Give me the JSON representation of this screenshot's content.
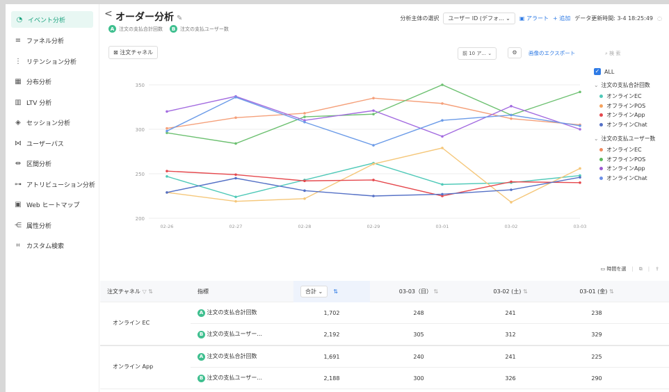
{
  "sidebar": {
    "items": [
      {
        "label": "イベント分析",
        "icon": "event-icon"
      },
      {
        "label": "ファネル分析",
        "icon": "funnel-icon"
      },
      {
        "label": "リテンション分析",
        "icon": "retention-icon"
      },
      {
        "label": "分布分析",
        "icon": "distribution-icon"
      },
      {
        "label": "LTV 分析",
        "icon": "ltv-icon"
      },
      {
        "label": "セッション分析",
        "icon": "session-icon"
      },
      {
        "label": "ユーザーパス",
        "icon": "path-icon"
      },
      {
        "label": "区間分析",
        "icon": "interval-icon"
      },
      {
        "label": "アトリビューション分析",
        "icon": "attribution-icon"
      },
      {
        "label": "Web ヒートマップ",
        "icon": "heatmap-icon"
      },
      {
        "label": "属性分析",
        "icon": "attribute-icon"
      },
      {
        "label": "カスタム検索",
        "icon": "custom-search-icon"
      }
    ]
  },
  "header": {
    "back": "<",
    "title": "オーダー分析",
    "metric_a": "注文の支払合計回数",
    "metric_b": "注文の支払ユーザー数",
    "subject_label": "分析主体の選択",
    "subject_value": "ユーザー ID (デフォ...",
    "alert": "アラート",
    "add": "+ 追加",
    "updated": "データ更新時間: 3-4 18:25:49"
  },
  "controls": {
    "channel": "注文チャネル",
    "prev": "前 10 ア...",
    "export": "画像のエクスポート",
    "search_placeholder": "検 索",
    "time_select": "時間を選"
  },
  "legend": {
    "all": "ALL",
    "groups": [
      {
        "name": "注文の支払合計回数",
        "items": [
          {
            "name": "オンラインEC",
            "color": "#4fc9b8"
          },
          {
            "name": "オフラインPOS",
            "color": "#f5a25d"
          },
          {
            "name": "オンラインApp",
            "color": "#e5484d"
          },
          {
            "name": "オンラインChat",
            "color": "#5470c6"
          }
        ]
      },
      {
        "name": "注文の支払ユーザー数",
        "items": [
          {
            "name": "オンラインEC",
            "color": "#f08a5d"
          },
          {
            "name": "オフラインPOS",
            "color": "#5cb85c"
          },
          {
            "name": "オンラインApp",
            "color": "#9b59d0"
          },
          {
            "name": "オンラインChat",
            "color": "#6b8fe8"
          }
        ]
      }
    ]
  },
  "chart_data": {
    "type": "line",
    "x": [
      "02-26",
      "02-27",
      "02-28",
      "02-29",
      "03-01",
      "03-02",
      "03-03"
    ],
    "ylim": [
      200,
      350
    ],
    "yticks": [
      200,
      250,
      300,
      350
    ],
    "series": [
      {
        "name": "注文の支払合計回数 - オンラインEC",
        "color": "#4fc9b8",
        "values": [
          247,
          224,
          243,
          262,
          238,
          240,
          248
        ]
      },
      {
        "name": "注文の支払合計回数 - オフラインPOS",
        "color": "#f5c77a",
        "values": [
          229,
          219,
          222,
          261,
          279,
          218,
          256
        ]
      },
      {
        "name": "注文の支払合計回数 - オンラインApp",
        "color": "#e5484d",
        "values": [
          253,
          249,
          242,
          243,
          225,
          241,
          240
        ]
      },
      {
        "name": "注文の支払合計回数 - オンラインChat",
        "color": "#5470c6",
        "values": [
          229,
          245,
          231,
          225,
          227,
          232,
          246
        ]
      },
      {
        "name": "注文の支払ユーザー数 - オンラインEC",
        "color": "#f5a07a",
        "values": [
          301,
          313,
          318,
          335,
          329,
          312,
          305
        ]
      },
      {
        "name": "注文の支払ユーザー数 - オフラインPOS",
        "color": "#6cc070",
        "values": [
          296,
          284,
          314,
          317,
          350,
          316,
          342
        ]
      },
      {
        "name": "注文の支払ユーザー数 - オンラインApp",
        "color": "#a36ce0",
        "values": [
          320,
          337,
          310,
          321,
          292,
          326,
          300
        ]
      },
      {
        "name": "注文の支払ユーザー数 - オンラインChat",
        "color": "#6b9be8",
        "values": [
          298,
          336,
          308,
          282,
          310,
          316,
          304
        ]
      }
    ]
  },
  "table": {
    "headers": [
      "注文チャネル",
      "指標",
      "合計",
      "03-03（日）",
      "03-02 (土)",
      "03-01 (金)"
    ],
    "sum_label": "合計",
    "groups": [
      {
        "channel": "オンライン EC",
        "rows": [
          {
            "badge": "A",
            "metric": "注文の支払合計回数",
            "total": "1,702",
            "d1": "248",
            "d2": "241",
            "d3": "238"
          },
          {
            "badge": "B",
            "metric": "注文の支払ユーザー...",
            "total": "2,192",
            "d1": "305",
            "d2": "312",
            "d3": "329"
          }
        ]
      },
      {
        "channel": "オンライン App",
        "rows": [
          {
            "badge": "A",
            "metric": "注文の支払合計回数",
            "total": "1,691",
            "d1": "240",
            "d2": "241",
            "d3": "225"
          },
          {
            "badge": "B",
            "metric": "注文の支払ユーザー...",
            "total": "2,188",
            "d1": "300",
            "d2": "326",
            "d3": "290"
          }
        ]
      }
    ]
  }
}
